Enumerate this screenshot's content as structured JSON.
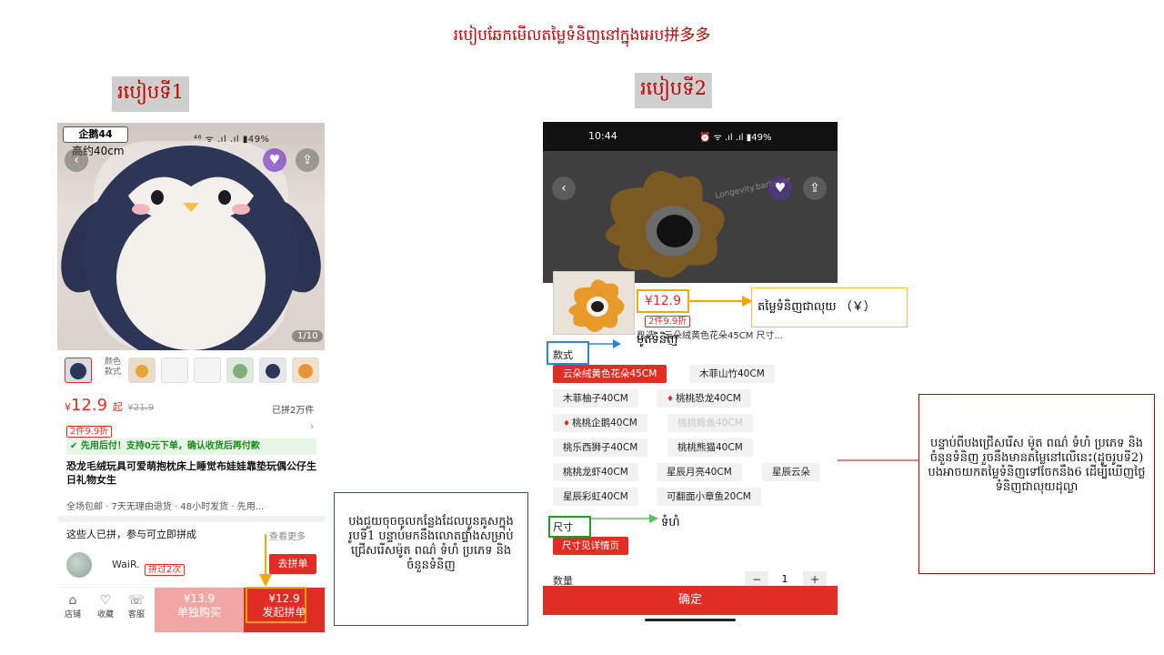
{
  "title": "របៀបឆែកមើលតម្លៃទំនិញនៅក្នុងអេប拼多多",
  "method1": {
    "label": "របៀបទី1",
    "badge": "企鹅44",
    "size_label": "高约40cm",
    "status_right": "⁴⁶ ᯤ .ıl .ıl ▮49%",
    "pager": "1/10",
    "thumb_text": "颜色\n款式",
    "price_symbol": "¥",
    "price": "12.9",
    "price_suffix": "起",
    "old_price": "¥21.9",
    "sold": "已拼2万件",
    "promo_tag": "2件9.9折",
    "pay_later": "先用后付！支持0元下单，确认收货后再付款",
    "product_desc": "恐龙毛绒玩具可爱萌抱枕床上睡觉布娃娃靠垫玩偶公仔生日礼物女生",
    "service": "全场包邮 · 7天无理由退货 · 48小时发货 · 先用...",
    "group_title": "这些人已拼，参与可立即拼成",
    "view_more": "查看更多",
    "user_name": "WaiR.",
    "user_need": "拼过2次",
    "join_button": "去拼单",
    "nav": [
      {
        "icon": "store-icon",
        "glyph": "⌂",
        "label": "店铺"
      },
      {
        "icon": "heart-icon",
        "glyph": "♡",
        "label": "收藏"
      },
      {
        "icon": "chat-icon",
        "glyph": "☏",
        "label": "客服"
      }
    ],
    "buy_single_price": "¥13.9",
    "buy_single_label": "单独购买",
    "buy_group_price": "¥12.9",
    "buy_group_label": "发起拼单"
  },
  "method2": {
    "label": "របៀបទី2",
    "time": "10:44",
    "status_right": "⏰ ᯤ .ıl .ıl ▮49%",
    "watermark": "Longevity.barberar",
    "price": "¥12.9",
    "discount_tag": "2件9.9折",
    "product_name": "已选：云朵绒黄色花朵45CM 尺寸...",
    "style_label": "款式",
    "options": [
      {
        "label": "云朵绒黄色花朵45CM",
        "state": "selected",
        "hot": false
      },
      {
        "label": "木菲山竹40CM",
        "state": "normal",
        "hot": false
      },
      {
        "label": "木菲柚子40CM",
        "state": "normal",
        "hot": false
      },
      {
        "label": "桃桃恐龙40CM",
        "state": "normal",
        "hot": true
      },
      {
        "label": "桃桃企鹅40CM",
        "state": "normal",
        "hot": true
      },
      {
        "label": "桃桃鲸鱼40CM",
        "state": "disabled",
        "hot": false
      },
      {
        "label": "桃乐西狮子40CM",
        "state": "normal",
        "hot": false
      },
      {
        "label": "桃桃熊猫40CM",
        "state": "normal",
        "hot": false
      },
      {
        "label": "桃桃龙虾40CM",
        "state": "normal",
        "hot": false
      },
      {
        "label": "星辰月亮40CM",
        "state": "normal",
        "hot": false
      },
      {
        "label": "星辰云朵",
        "state": "normal",
        "hot": false
      },
      {
        "label": "星辰彩虹40CM",
        "state": "normal",
        "hot": false
      },
      {
        "label": "可翻面小章鱼20CM",
        "state": "normal",
        "hot": false
      }
    ],
    "size_label": "尺寸",
    "size_button": "尺寸见详情页",
    "qty_label": "数量",
    "qty_value": "1",
    "qty_minus": "−",
    "qty_plus": "+",
    "confirm": "确定"
  },
  "annotations": {
    "price_in_yuan": "តម្លៃទំនិញជាលុយ （￥）",
    "style_note": "ម៉ូតទំនិញ",
    "size_note": "ទំហំ",
    "callout1": "បងជួយចុចចូលកន្លែងដែលបួនគូសក្នុងរូបទី1 បន្ទាប់មកនឹងលោតផ្ទាំងសម្រាប់ជ្រើសរើសម៉ូត ពណ៌ ទំហំ ប្រភេទ និងចំនួនទំនិញ",
    "callout2": "បន្ទាប់ពីបងជ្រើសរើស ម៉ូត ពណ៌ ទំហំ ប្រភេទ និងចំនួនទំនិញ រួចនឹងមានតម្លៃនៅលើនេះ(ដូចរូបទី2) បងអាចយកតម្លៃទំនិញទៅចែកនឹង6 ដើម្បីឃើញថ្លៃទំនិញជាលុយដុល្លា"
  },
  "colors": {
    "accent_red": "#e02e24",
    "highlight_orange": "#f5a800",
    "highlight_blue": "#2a86d6",
    "highlight_green": "#20a020",
    "title_red": "#c00000"
  }
}
